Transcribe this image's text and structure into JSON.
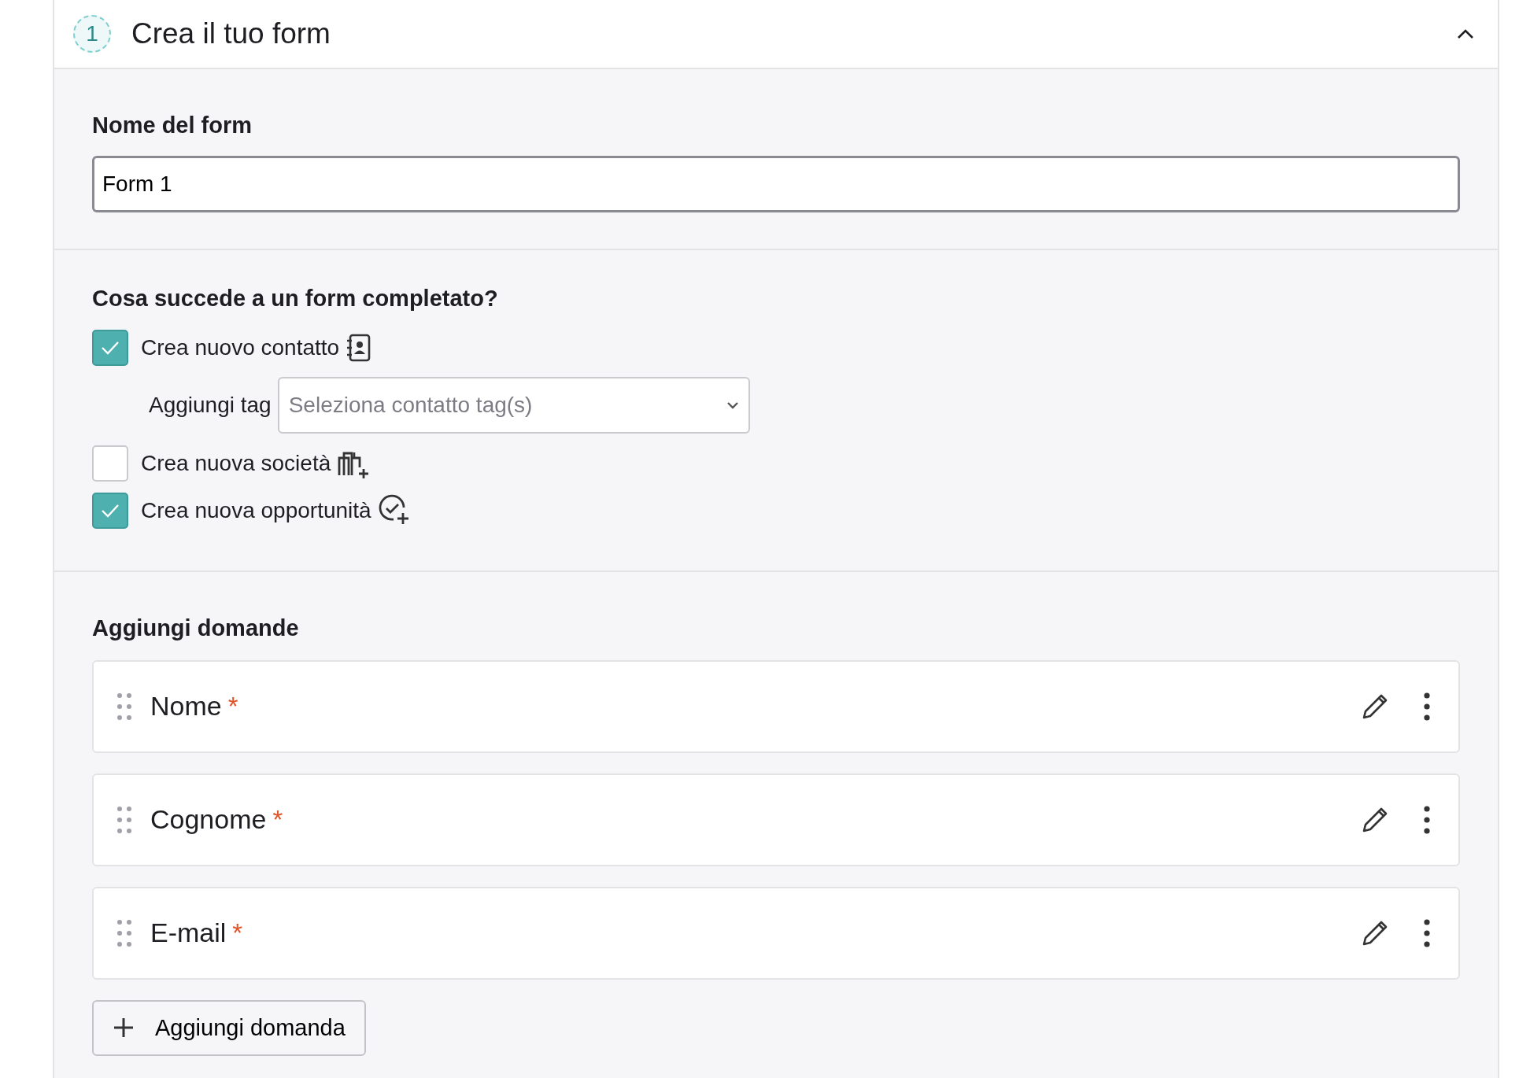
{
  "header": {
    "step": "1",
    "title": "Crea il tuo form",
    "expanded": true
  },
  "form_name": {
    "label": "Nome del form",
    "value": "Form 1"
  },
  "actions": {
    "title": "Cosa succede a un form completato?",
    "options": [
      {
        "label": "Crea nuovo contatto",
        "checked": true,
        "tag": {
          "label": "Aggiungi tag",
          "placeholder": "Seleziona contatto tag(s)"
        }
      },
      {
        "label": "Crea nuova società",
        "checked": false
      },
      {
        "label": "Crea nuova opportunità",
        "checked": true
      }
    ]
  },
  "questions": {
    "title": "Aggiungi domande",
    "items": [
      {
        "label": "Nome",
        "required_mark": "*"
      },
      {
        "label": "Cognome",
        "required_mark": "*"
      },
      {
        "label": "E-mail",
        "required_mark": "*"
      }
    ],
    "add_button": "Aggiungi domanda"
  }
}
